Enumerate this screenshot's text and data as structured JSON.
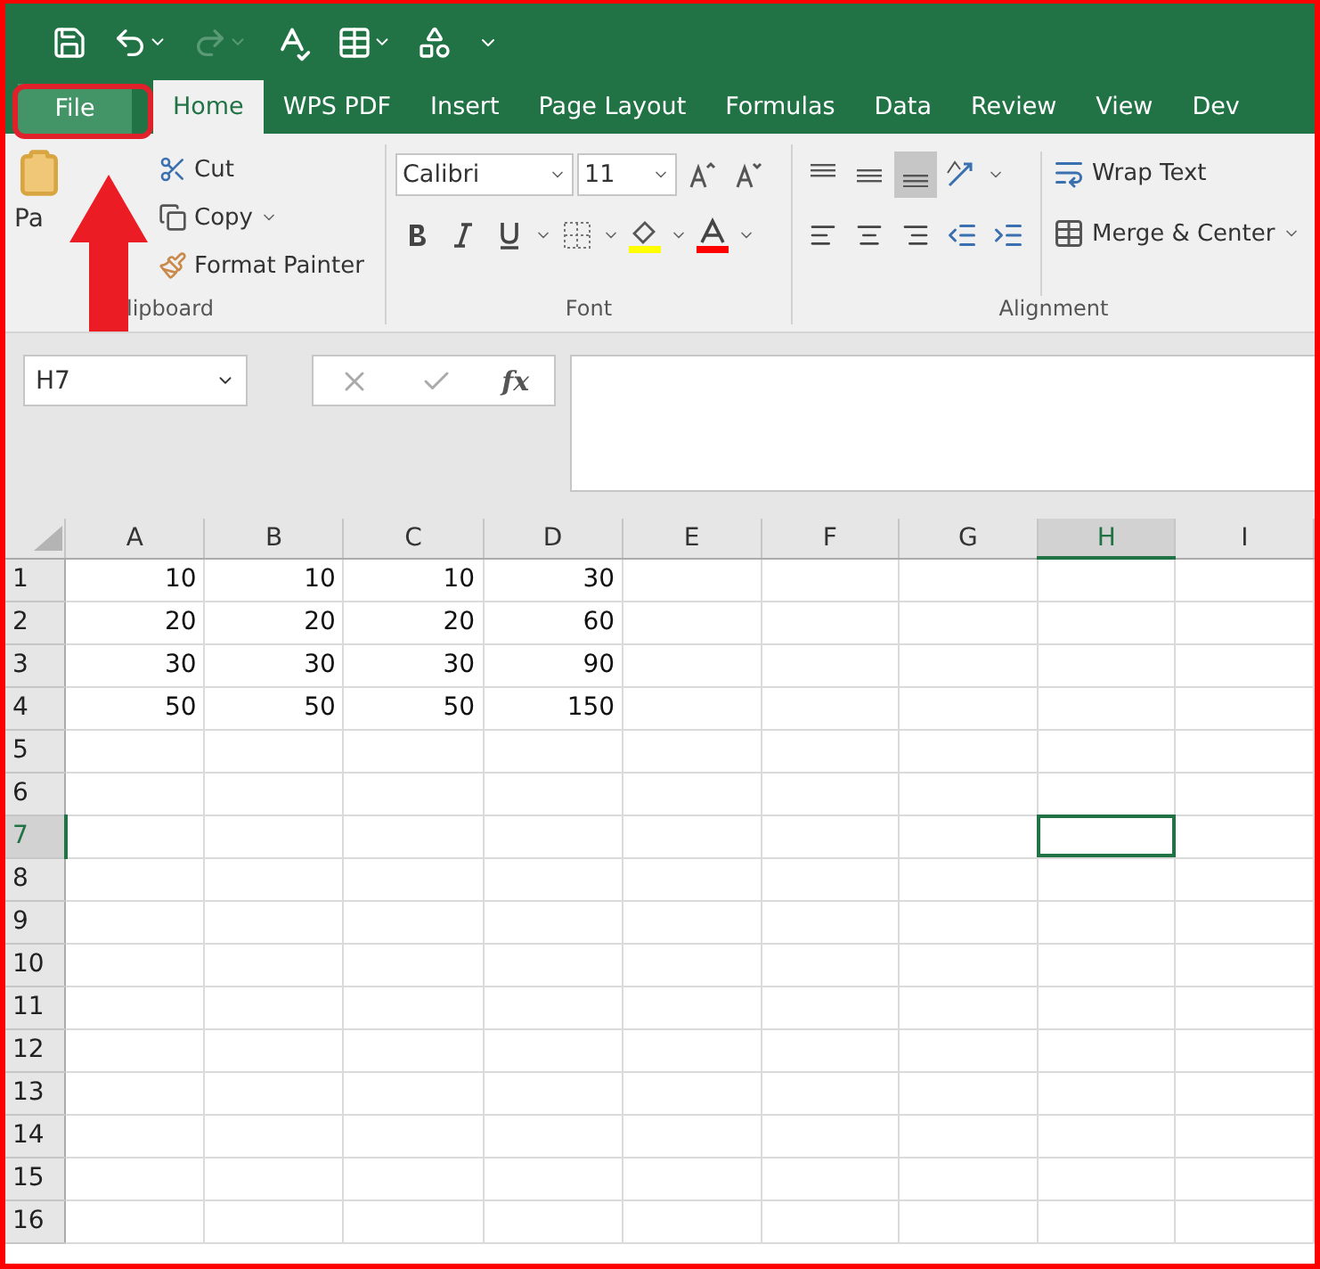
{
  "tabs": [
    {
      "label": "File",
      "kind": "file",
      "selected": false
    },
    {
      "label": "Home",
      "kind": "tab",
      "selected": true
    },
    {
      "label": "WPS PDF",
      "kind": "tab",
      "selected": false
    },
    {
      "label": "Insert",
      "kind": "tab",
      "selected": false
    },
    {
      "label": "Page Layout",
      "kind": "tab",
      "selected": false
    },
    {
      "label": "Formulas",
      "kind": "tab",
      "selected": false
    },
    {
      "label": "Data",
      "kind": "tab",
      "selected": false
    },
    {
      "label": "Review",
      "kind": "tab",
      "selected": false
    },
    {
      "label": "View",
      "kind": "tab",
      "selected": false
    },
    {
      "label": "Dev",
      "kind": "tab",
      "selected": false
    }
  ],
  "clipboard": {
    "paste_label": "Pa",
    "items": [
      "Cut",
      "Copy",
      "Format Painter"
    ],
    "label": "lipboard"
  },
  "font": {
    "name": "Calibri",
    "size": "11",
    "label": "Font"
  },
  "alignment": {
    "vertical": [
      {
        "selected": false
      },
      {
        "selected": false
      },
      {
        "selected": true
      }
    ],
    "wrap": "Wrap Text",
    "merge": "Merge & Center",
    "label": "Alignment"
  },
  "name_box": "H7",
  "formula_label": "fx",
  "sheet": {
    "columns": [
      {
        "label": "A",
        "selected": false
      },
      {
        "label": "B",
        "selected": false
      },
      {
        "label": "C",
        "selected": false
      },
      {
        "label": "D",
        "selected": false
      },
      {
        "label": "E",
        "selected": false
      },
      {
        "label": "F",
        "selected": false
      },
      {
        "label": "G",
        "selected": false
      },
      {
        "label": "H",
        "selected": true
      },
      {
        "label": "I",
        "selected": false
      }
    ],
    "rows": [
      {
        "header": "1",
        "selected": false,
        "cells": [
          "10",
          "10",
          "10",
          "30"
        ]
      },
      {
        "header": "2",
        "selected": false,
        "cells": [
          "20",
          "20",
          "20",
          "60"
        ]
      },
      {
        "header": "3",
        "selected": false,
        "cells": [
          "30",
          "30",
          "30",
          "90"
        ]
      },
      {
        "header": "4",
        "selected": false,
        "cells": [
          "50",
          "50",
          "50",
          "150"
        ]
      },
      {
        "header": "5",
        "selected": false
      },
      {
        "header": "6",
        "selected": false
      },
      {
        "header": "7",
        "selected": true
      },
      {
        "header": "8",
        "selected": false
      },
      {
        "header": "9",
        "selected": false
      },
      {
        "header": "10",
        "selected": false
      },
      {
        "header": "11",
        "selected": false
      },
      {
        "header": "12",
        "selected": false
      },
      {
        "header": "13",
        "selected": false
      },
      {
        "header": "14",
        "selected": false
      },
      {
        "header": "15",
        "selected": false
      },
      {
        "header": "16",
        "selected": false
      }
    ]
  }
}
